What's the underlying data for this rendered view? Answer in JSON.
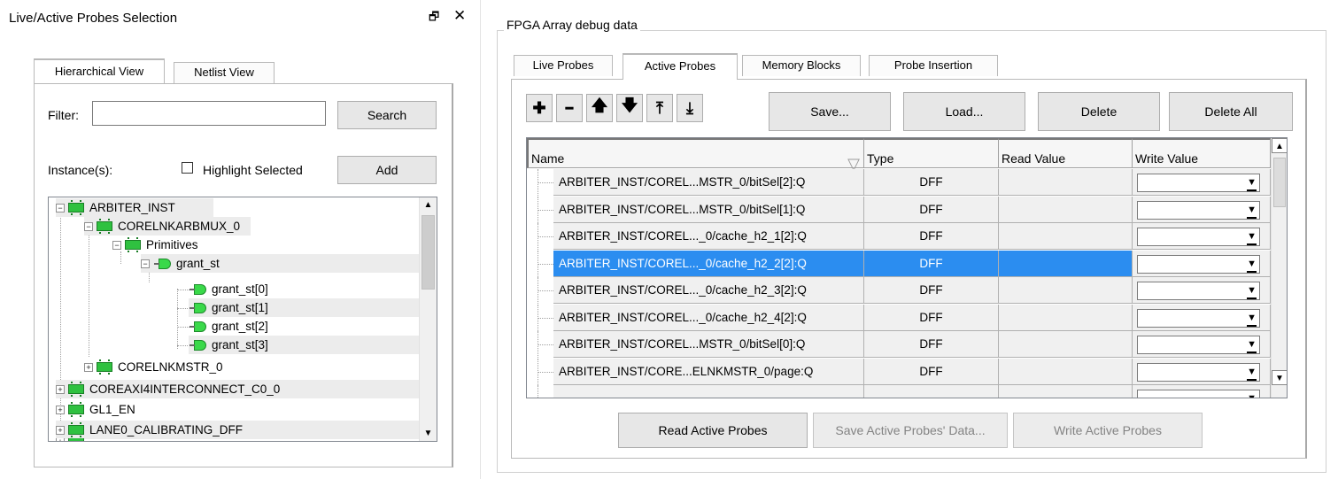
{
  "left_panel": {
    "title": "Live/Active Probes Selection",
    "float_glyph": "ð",
    "close_glyph": "✕",
    "tabs": [
      {
        "label": "Hierarchical View",
        "active": true
      },
      {
        "label": "Netlist View",
        "active": false
      }
    ],
    "filter_label": "Filter:",
    "filter_value": "",
    "search_label": "Search",
    "instances_label": "Instance(s):",
    "highlight_label": "Highlight Selected",
    "highlight_checked": false,
    "add_label": "Add",
    "tree": [
      {
        "label": "ARBITER_INST",
        "expander": "−",
        "icon": "chip-icon",
        "shaded": true
      },
      {
        "label": "CORELNKARBMUX_0",
        "expander": "−",
        "icon": "chip-icon",
        "shaded": true
      },
      {
        "label": "Primitives",
        "expander": "−",
        "icon": "chip-icon",
        "shaded": false
      },
      {
        "label": "grant_st",
        "expander": "−",
        "icon": "probe-icon",
        "shaded": true
      },
      {
        "label": "grant_st[0]",
        "expander": "",
        "icon": "probe-icon",
        "shaded": false
      },
      {
        "label": "grant_st[1]",
        "expander": "",
        "icon": "probe-icon",
        "shaded": true
      },
      {
        "label": "grant_st[2]",
        "expander": "",
        "icon": "probe-icon",
        "shaded": false
      },
      {
        "label": "grant_st[3]",
        "expander": "",
        "icon": "probe-icon",
        "shaded": true
      },
      {
        "label": "CORELNKMSTR_0",
        "expander": "+",
        "icon": "chip-icon",
        "shaded": false
      },
      {
        "label": "COREAXI4INTERCONNECT_C0_0",
        "expander": "+",
        "icon": "chip-icon",
        "shaded": true
      },
      {
        "label": "GL1_EN",
        "expander": "+",
        "icon": "chip-icon",
        "shaded": false
      },
      {
        "label": "LANE0_CALIBRATING_DFF",
        "expander": "+",
        "icon": "chip-icon",
        "shaded": true
      }
    ]
  },
  "right_panel": {
    "group_title": "FPGA Array debug data",
    "tabs": [
      {
        "label": "Live Probes",
        "active": false
      },
      {
        "label": "Active Probes",
        "active": true
      },
      {
        "label": "Memory Blocks",
        "active": false
      },
      {
        "label": "Probe Insertion",
        "active": false
      }
    ],
    "toolbar": {
      "add_glyph": "✚",
      "remove_glyph": "━",
      "up_glyph": "🡅",
      "down_glyph": "🡇",
      "top_glyph": "⤒",
      "bottom_glyph": "⤓",
      "save_label": "Save...",
      "load_label": "Load...",
      "delete_label": "Delete",
      "delete_all_label": "Delete All"
    },
    "table": {
      "columns": [
        "Name",
        "Type",
        "Read Value",
        "Write Value"
      ],
      "sort_glyph": "▽",
      "rows": [
        {
          "name": "ARBITER_INST/COREL...MSTR_0/bitSel[2]:Q",
          "type": "DFF",
          "read": "",
          "write": "",
          "selected": false
        },
        {
          "name": "ARBITER_INST/COREL...MSTR_0/bitSel[1]:Q",
          "type": "DFF",
          "read": "",
          "write": "",
          "selected": false
        },
        {
          "name": "ARBITER_INST/COREL..._0/cache_h2_1[2]:Q",
          "type": "DFF",
          "read": "",
          "write": "",
          "selected": false
        },
        {
          "name": "ARBITER_INST/COREL..._0/cache_h2_2[2]:Q",
          "type": "DFF",
          "read": "",
          "write": "",
          "selected": true
        },
        {
          "name": "ARBITER_INST/COREL..._0/cache_h2_3[2]:Q",
          "type": "DFF",
          "read": "",
          "write": "",
          "selected": false
        },
        {
          "name": "ARBITER_INST/COREL..._0/cache_h2_4[2]:Q",
          "type": "DFF",
          "read": "",
          "write": "",
          "selected": false
        },
        {
          "name": "ARBITER_INST/COREL...MSTR_0/bitSel[0]:Q",
          "type": "DFF",
          "read": "",
          "write": "",
          "selected": false
        },
        {
          "name": "ARBITER_INST/CORE...ELNKMSTR_0/page:Q",
          "type": "DFF",
          "read": "",
          "write": "",
          "selected": false
        },
        {
          "name": "",
          "type": "",
          "read": "",
          "write": "",
          "selected": false
        }
      ]
    },
    "read_active_label": "Read Active Probes",
    "save_active_label": "Save Active Probes' Data...",
    "write_active_label": "Write Active Probes"
  },
  "colors": {
    "selection": "#2b8df0",
    "chip_green": "#2fc140"
  }
}
